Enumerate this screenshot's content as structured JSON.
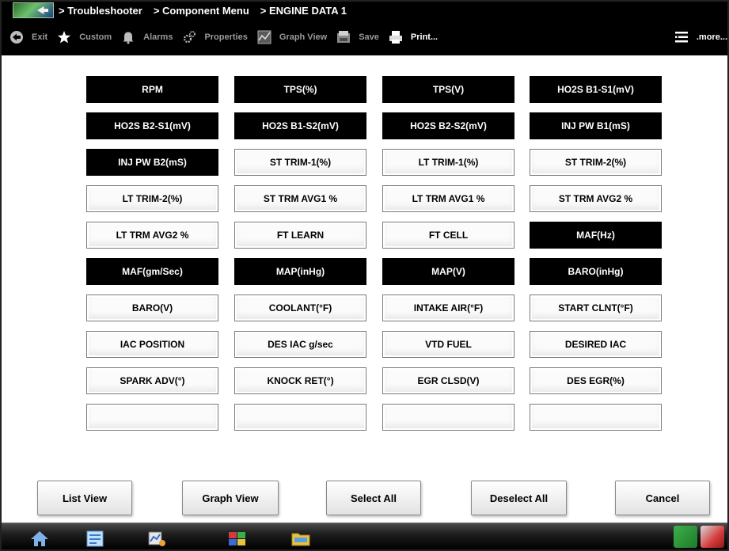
{
  "titlebar": {
    "breadcrumbs": [
      "> Troubleshooter",
      "> Component Menu",
      "> ENGINE DATA 1"
    ]
  },
  "toolbar": {
    "exit": {
      "label": "Exit",
      "icon": "exit-arrow-icon"
    },
    "custom": {
      "label": "Custom",
      "icon": "star-icon"
    },
    "alarms": {
      "label": "Alarms",
      "icon": "alarm-bell-icon"
    },
    "properties": {
      "label": "Properties",
      "icon": "gears-icon"
    },
    "graph_view": {
      "label": "Graph View",
      "icon": "graph-icon"
    },
    "save": {
      "label": "Save",
      "icon": "save-icon"
    },
    "print": {
      "label": "Print...",
      "icon": "printer-icon"
    },
    "more": {
      "label": ".more...",
      "icon": "menu-lines-icon"
    }
  },
  "pids": [
    {
      "label": "RPM",
      "selected": true
    },
    {
      "label": "TPS(%)",
      "selected": true
    },
    {
      "label": "TPS(V)",
      "selected": true
    },
    {
      "label": "HO2S B1-S1(mV)",
      "selected": true
    },
    {
      "label": "HO2S B2-S1(mV)",
      "selected": true
    },
    {
      "label": "HO2S B1-S2(mV)",
      "selected": true
    },
    {
      "label": "HO2S B2-S2(mV)",
      "selected": true
    },
    {
      "label": "INJ PW B1(mS)",
      "selected": true
    },
    {
      "label": "INJ PW B2(mS)",
      "selected": true
    },
    {
      "label": "ST TRIM-1(%)",
      "selected": false
    },
    {
      "label": "LT TRIM-1(%)",
      "selected": false
    },
    {
      "label": "ST TRIM-2(%)",
      "selected": false
    },
    {
      "label": "LT TRIM-2(%)",
      "selected": false
    },
    {
      "label": "ST TRM AVG1 %",
      "selected": false
    },
    {
      "label": "LT TRM AVG1 %",
      "selected": false
    },
    {
      "label": "ST TRM AVG2 %",
      "selected": false
    },
    {
      "label": "LT TRM AVG2 %",
      "selected": false
    },
    {
      "label": "FT LEARN",
      "selected": false
    },
    {
      "label": "FT CELL",
      "selected": false
    },
    {
      "label": "MAF(Hz)",
      "selected": true
    },
    {
      "label": "MAF(gm/Sec)",
      "selected": true
    },
    {
      "label": "MAP(inHg)",
      "selected": true
    },
    {
      "label": "MAP(V)",
      "selected": true
    },
    {
      "label": "BARO(inHg)",
      "selected": true
    },
    {
      "label": "BARO(V)",
      "selected": false
    },
    {
      "label": "COOLANT(°F)",
      "selected": false
    },
    {
      "label": "INTAKE AIR(°F)",
      "selected": false
    },
    {
      "label": "START CLNT(°F)",
      "selected": false
    },
    {
      "label": "IAC POSITION",
      "selected": false
    },
    {
      "label": "DES IAC g/sec",
      "selected": false
    },
    {
      "label": "VTD FUEL",
      "selected": false
    },
    {
      "label": "DESIRED IAC",
      "selected": false
    },
    {
      "label": "SPARK ADV(°)",
      "selected": false
    },
    {
      "label": "KNOCK RET(°)",
      "selected": false
    },
    {
      "label": "EGR CLSD(V)",
      "selected": false
    },
    {
      "label": "DES EGR(%)",
      "selected": false
    },
    {
      "label": "",
      "selected": false
    },
    {
      "label": "",
      "selected": false
    },
    {
      "label": "",
      "selected": false
    },
    {
      "label": "",
      "selected": false
    }
  ],
  "actions": {
    "list_view": "List View",
    "graph_view": "Graph View",
    "select_all": "Select All",
    "deselect_all": "Deselect All",
    "cancel": "Cancel"
  },
  "taskbar": {
    "icons": [
      "home-icon",
      "document-icon",
      "data-scan-icon",
      "puzzle-icon",
      "folder-icon"
    ],
    "tray_icons": [
      "flag-icon",
      "network-icon"
    ]
  }
}
